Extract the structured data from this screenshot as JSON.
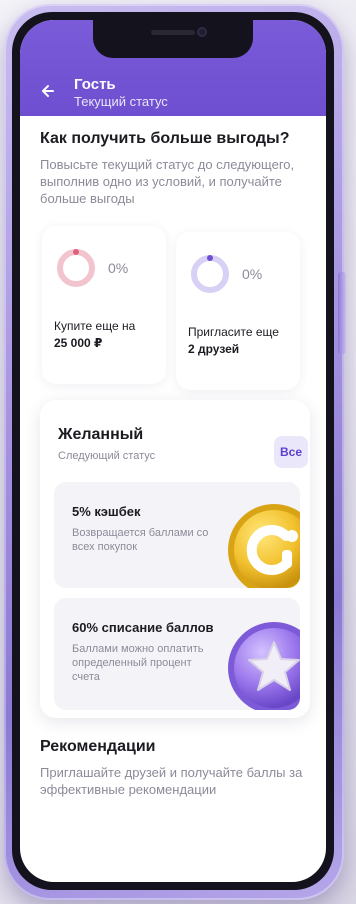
{
  "header": {
    "title": "Гость",
    "subtitle": "Текущий статус"
  },
  "main": {
    "heading": "Как получить больше выгоды?",
    "description": "Повысьте текущий статус до следующего, выполнив одно из условий, и получайте больше выгоды"
  },
  "conditions": [
    {
      "percent_label": "0%",
      "progress": 0,
      "ring_color": "#f2c4cd",
      "dot_color": "#e0607a",
      "label": "Купите еще на",
      "value": "25 000 ₽"
    },
    {
      "percent_label": "0%",
      "progress": 0,
      "ring_color": "#d8d0f5",
      "dot_color": "#6d4fd0",
      "label": "Пригласите еще",
      "value": "2 друзей"
    }
  ],
  "next_status": {
    "title": "Желанный",
    "subtitle": "Следующий статус",
    "all_button": "Все",
    "benefits": [
      {
        "title": "5% кэшбек",
        "description": "Возвращается баллами со всех покупок",
        "icon": "coin-g-icon"
      },
      {
        "title": "60% списание баллов",
        "description": "Баллами можно оплатить определенный процент счета",
        "icon": "star-coin-icon"
      }
    ]
  },
  "recommendations": {
    "title": "Рекомендации",
    "description": "Приглашайте друзей и получайте баллы за эффективные рекомендации"
  },
  "colors": {
    "accent": "#6d4fd0",
    "frame": "#a795e2"
  }
}
